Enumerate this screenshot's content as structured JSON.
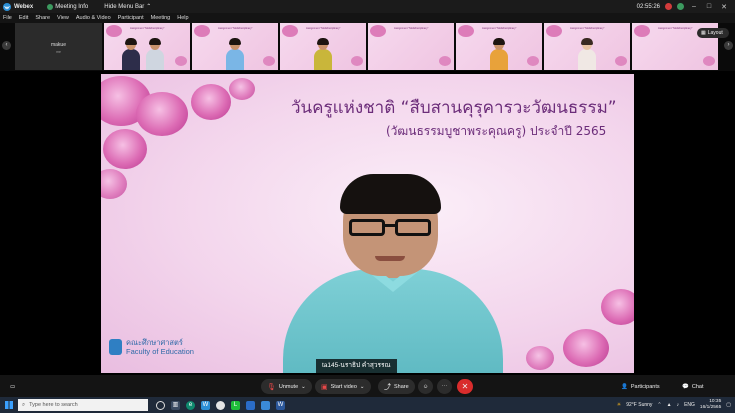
{
  "titlebar": {
    "app_name": "Webex",
    "meeting_info": "Meeting Info",
    "hide_menu": "Hide Menu Bar",
    "time": "02:55:26"
  },
  "menu": [
    "File",
    "Edit",
    "Share",
    "View",
    "Audio & Video",
    "Participant",
    "Meeting",
    "Help"
  ],
  "strip": {
    "self_name": "makue",
    "self_sub": "me",
    "thumb_title": "Assignment \"Multidisciplinary\"",
    "layout_label": "Layout"
  },
  "slide": {
    "title": "วันครูแห่งชาติ “สืบสานคุรุคารวะวัฒนธรรม”",
    "subtitle": "(วัฒนธรรมบูชาพระคุณครู) ประจำปี 2565",
    "faculty_th": "คณะศึกษาศาสตร์",
    "faculty_en": "Faculty of Education"
  },
  "speaker_name": "ta145-นราธิป คำสุวรรณ",
  "controls": {
    "unmute": "Unmute",
    "start_video": "Start video",
    "share": "Share",
    "participants": "Participants",
    "chat": "Chat"
  },
  "taskbar": {
    "search_placeholder": "Type here to search",
    "weather": "92°F  Sunny",
    "lang": "ENG",
    "time": "10:35",
    "date": "16/1/2565"
  },
  "colors": {
    "accent_red": "#d92c2c",
    "slide_text": "#6c2d7a",
    "shirt": "#7fd0d6"
  }
}
